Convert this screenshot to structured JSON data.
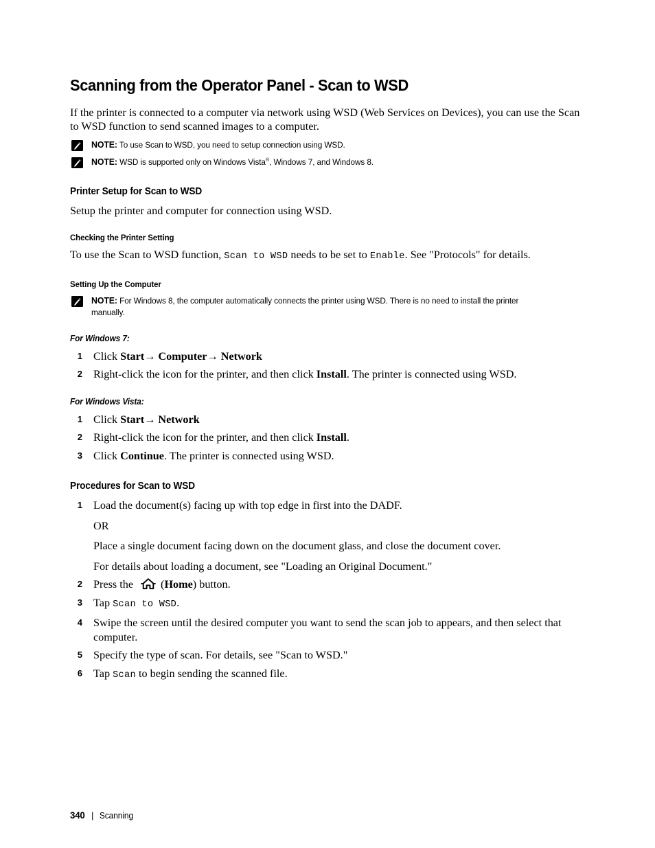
{
  "page": {
    "title": "Scanning from the Operator Panel - Scan to WSD",
    "intro": "If the printer is connected to a computer via network using WSD (Web Services on Devices), you can use the Scan to WSD function to send scanned images to a computer."
  },
  "notes": {
    "note_label": "NOTE:",
    "note1": "To use Scan to WSD, you need to setup connection using WSD.",
    "note2_pre": "WSD is supported only on Windows Vista",
    "note2_sup": "®",
    "note2_post": ", Windows 7, and Windows 8.",
    "note3": "For Windows 8, the computer automatically connects the printer using WSD. There is no need to install the printer manually."
  },
  "printer_setup": {
    "heading": "Printer Setup for Scan to WSD",
    "body": "Setup the printer and computer for connection using WSD."
  },
  "checking_setting": {
    "heading": "Checking the Printer Setting",
    "text_1": "To use the Scan to WSD function, ",
    "code_1": "Scan to WSD",
    "text_2": " needs to be set to ",
    "code_2": "Enable",
    "text_3": ". See \"Protocols\"  for details."
  },
  "setting_up": {
    "heading": "Setting Up the Computer"
  },
  "windows7": {
    "heading": "For Windows 7:",
    "steps": [
      {
        "num": "1",
        "text_1": "Click ",
        "bold_1": "Start",
        "arrow_1": "→",
        "bold_2": " Computer",
        "arrow_2": "→",
        "bold_3": " Network"
      },
      {
        "num": "2",
        "text_1": "Right-click the icon for the printer, and then click ",
        "bold_1": "Install",
        "text_2": ". The printer is connected using WSD."
      }
    ]
  },
  "windows_vista": {
    "heading": "For Windows Vista:",
    "steps": [
      {
        "num": "1",
        "text_1": "Click ",
        "bold_1": "Start",
        "arrow_1": "→",
        "bold_2": " Network"
      },
      {
        "num": "2",
        "text_1": "Right-click the icon for the printer, and then click ",
        "bold_1": "Install",
        "text_2": "."
      },
      {
        "num": "3",
        "text_1": "Click ",
        "bold_1": "Continue",
        "text_2": ". The printer is connected using WSD."
      }
    ]
  },
  "procedures": {
    "heading": "Procedures for Scan to WSD",
    "step1": {
      "num": "1",
      "line1": "Load the document(s) facing up with top edge in first into the DADF.",
      "line2": "OR",
      "line3": "Place a single document facing down on the document glass, and close the document cover.",
      "line4": "For details about loading a document, see \"Loading an Original Document.\""
    },
    "step2": {
      "num": "2",
      "text_1": "Press the ",
      "icon": "home-icon",
      "text_2": "(",
      "bold_1": "Home",
      "text_3": ") button."
    },
    "step3": {
      "num": "3",
      "text_1": "Tap ",
      "code_1": "Scan to WSD",
      "text_2": "."
    },
    "step4": {
      "num": "4",
      "text_1": "Swipe the screen until the desired computer you want to send the scan job to appears, and then select that computer."
    },
    "step5": {
      "num": "5",
      "text_1": "Specify the type of scan. For details, see \"Scan to WSD.\""
    },
    "step6": {
      "num": "6",
      "text_1": "Tap ",
      "code_1": "Scan",
      "text_2": " to begin sending the scanned file."
    }
  },
  "footer": {
    "page_number": "340",
    "separator": "|",
    "chapter": "Scanning"
  }
}
